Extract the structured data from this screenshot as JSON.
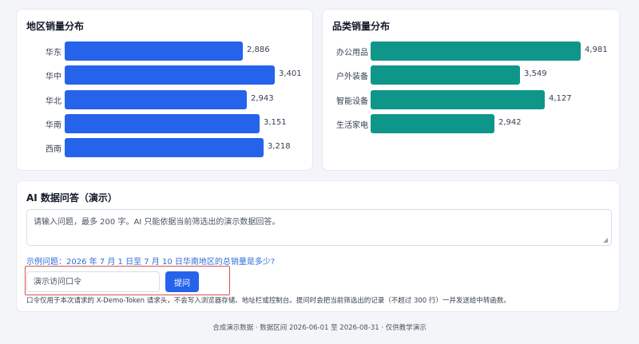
{
  "region_panel": {
    "title": "地区销量分布"
  },
  "category_panel": {
    "title": "品类销量分布"
  },
  "chart_data": [
    {
      "type": "bar",
      "orientation": "horizontal",
      "title": "地区销量分布",
      "categories": [
        "华东",
        "华中",
        "华北",
        "华南",
        "西南"
      ],
      "values": [
        2886,
        3401,
        2943,
        3151,
        3218
      ],
      "value_labels": [
        "2,886",
        "3,401",
        "2,943",
        "3,151",
        "3,218"
      ],
      "color": "#2563eb"
    },
    {
      "type": "bar",
      "orientation": "horizontal",
      "title": "品类销量分布",
      "categories": [
        "办公用品",
        "户外装备",
        "智能设备",
        "生活家电"
      ],
      "values": [
        4981,
        3549,
        4127,
        2942
      ],
      "value_labels": [
        "4,981",
        "3,549",
        "4,127",
        "2,942"
      ],
      "color": "#0f968a"
    }
  ],
  "ai_panel": {
    "title": "AI 数据问答（演示）",
    "question_placeholder": "请输入问题，最多 200 字。AI 只能依据当前筛选出的演示数据回答。",
    "example_question": "示例问题：2026 年 7 月 1 日至 7 月 10 日华南地区的总销量是多少?",
    "passcode_placeholder": "演示访问口令",
    "ask_button_label": "提问",
    "hint": "口令仅用于本次请求的 X-Demo-Token 请求头，不会写入浏览器存储、地址栏或控制台。提问时会把当前筛选出的记录（不超过 300 行）一并发送给中转函数。"
  },
  "footer": {
    "text": "合成演示数据 · 数据区间 2026-06-01 至 2026-08-31 · 仅供教学演示"
  }
}
